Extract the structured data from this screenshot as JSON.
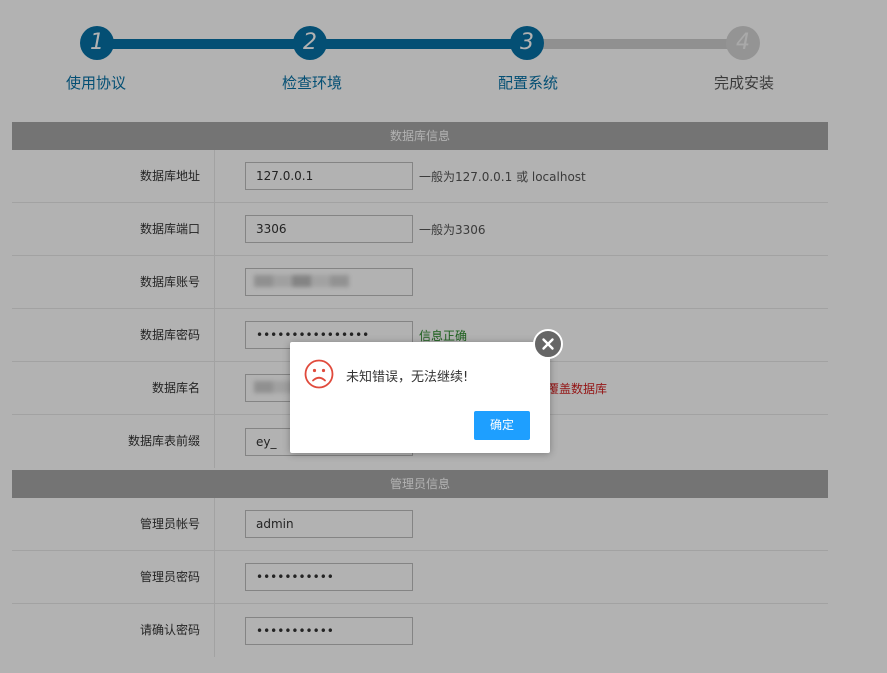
{
  "steps": [
    {
      "number": "1",
      "label": "使用协议",
      "state": "done"
    },
    {
      "number": "2",
      "label": "检查环境",
      "state": "done"
    },
    {
      "number": "3",
      "label": "配置系统",
      "state": "done"
    },
    {
      "number": "4",
      "label": "完成安装",
      "state": "todo"
    }
  ],
  "colors": {
    "accent": "#0672a6",
    "inactive": "#cfcfcf",
    "ok_button": "#1e9fff",
    "error": "#d42020",
    "success": "#2a8a2a"
  },
  "database_section": {
    "title": "数据库信息",
    "fields": {
      "host": {
        "label": "数据库地址",
        "value": "127.0.0.1",
        "hint": "一般为127.0.0.1 或 localhost"
      },
      "port": {
        "label": "数据库端口",
        "value": "3306",
        "hint": "一般为3306"
      },
      "user": {
        "label": "数据库账号",
        "value": ""
      },
      "password": {
        "label": "数据库密码",
        "value": "••••••••••••••••",
        "hint": "信息正确"
      },
      "name": {
        "label": "数据库名",
        "value": "",
        "hint": "覆盖数据库"
      },
      "prefix": {
        "label": "数据库表前缀",
        "value": "ey_"
      }
    }
  },
  "admin_section": {
    "title": "管理员信息",
    "fields": {
      "account": {
        "label": "管理员帐号",
        "value": "admin"
      },
      "password": {
        "label": "管理员密码",
        "value": "•••••••••••"
      },
      "confirm": {
        "label": "请确认密码",
        "value": "•••••••••••"
      }
    }
  },
  "dialog": {
    "message": "未知错误，无法继续!",
    "ok_label": "确定",
    "icon": "sad-face-icon",
    "close_icon": "close-icon"
  }
}
